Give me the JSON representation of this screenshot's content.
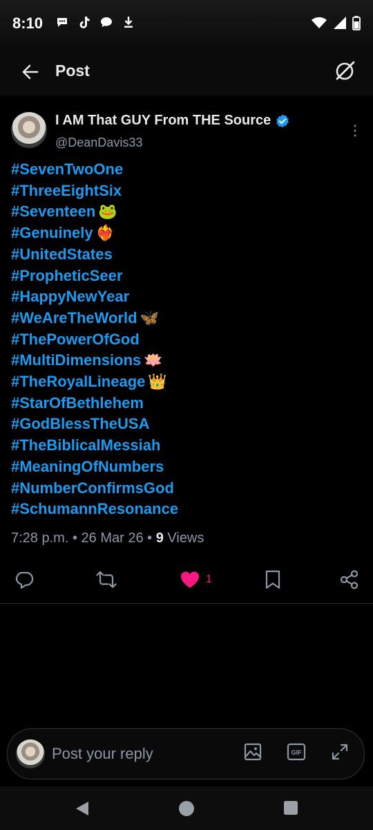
{
  "status_bar": {
    "time": "8:10",
    "left_icons": [
      "chat-bubble-icon",
      "tiktok-icon",
      "message-icon",
      "download-icon"
    ],
    "right_icons": [
      "wifi-icon",
      "signal-icon",
      "battery-icon"
    ]
  },
  "header": {
    "title": "Post",
    "back_icon": "arrow-left-icon",
    "grok_icon": "grok-icon"
  },
  "post": {
    "display_name": "I AM That GUY From THE Source",
    "handle": "@DeanDavis33",
    "verified": true,
    "hashtags": [
      {
        "text": "#SevenTwoOne",
        "emoji": ""
      },
      {
        "text": "#ThreeEightSix",
        "emoji": ""
      },
      {
        "text": "#Seventeen",
        "emoji": "🐸"
      },
      {
        "text": "#Genuinely",
        "emoji": "❤️‍🔥"
      },
      {
        "text": "#UnitedStates",
        "emoji": ""
      },
      {
        "text": "#PropheticSeer",
        "emoji": ""
      },
      {
        "text": "#HappyNewYear",
        "emoji": ""
      },
      {
        "text": "#WeAreTheWorld",
        "emoji": "🦋"
      },
      {
        "text": "#ThePowerOfGod",
        "emoji": ""
      },
      {
        "text": "#MultiDimensions",
        "emoji": "🪷"
      },
      {
        "text": "#TheRoyalLineage",
        "emoji": "👑"
      },
      {
        "text": "#StarOfBethlehem",
        "emoji": ""
      },
      {
        "text": "#GodBlessTheUSA",
        "emoji": ""
      },
      {
        "text": "#TheBiblicalMessiah",
        "emoji": ""
      },
      {
        "text": "#MeaningOfNumbers",
        "emoji": ""
      },
      {
        "text": "#NumberConfirmsGod",
        "emoji": ""
      },
      {
        "text": "#SchumannResonance",
        "emoji": ""
      }
    ],
    "time": "7:28 p.m.",
    "date": "26 Mar 26",
    "views_count": "9",
    "views_label": "Views",
    "like_count": "1"
  },
  "reply": {
    "placeholder": "Post your reply"
  },
  "colors": {
    "link": "#1d9bf0",
    "like": "#f91880",
    "muted": "#8b98a5",
    "text": "#e7e9ea"
  }
}
